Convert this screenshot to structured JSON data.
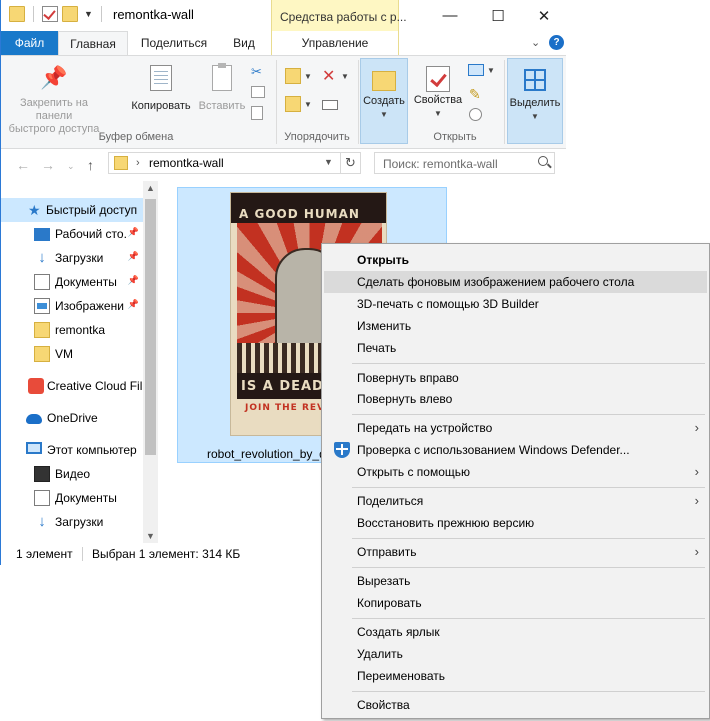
{
  "window": {
    "title": "remontka-wall",
    "tools_tab": "Средства работы с р...",
    "controls": {
      "minimize": "—",
      "maximize": "☐",
      "close": "✕"
    }
  },
  "ribbon_tabs": {
    "file": "Файл",
    "home": "Главная",
    "share": "Поделиться",
    "view": "Вид",
    "manage": "Управление",
    "help": "?"
  },
  "ribbon": {
    "pin": "Закрепить на панели быстрого доступа",
    "pin_l1": "Закрепить на панели",
    "pin_l2": "быстрого доступа",
    "copy": "Копировать",
    "paste": "Вставить",
    "clipboard_group": "Буфер обмена",
    "organize_group": "Упорядочить",
    "new": "Создать",
    "properties": "Свойства",
    "open_group": "Открыть",
    "select": "Выделить"
  },
  "address": {
    "path": "remontka-wall",
    "search_placeholder": "Поиск: remontka-wall"
  },
  "nav": {
    "items": [
      {
        "label": "Быстрый доступ",
        "icon": "star-icon"
      },
      {
        "label": "Рабочий сто.",
        "icon": "desktop-icon"
      },
      {
        "label": "Загрузки",
        "icon": "download-icon"
      },
      {
        "label": "Документы",
        "icon": "documents-icon"
      },
      {
        "label": "Изображени",
        "icon": "pictures-icon"
      },
      {
        "label": "remontka",
        "icon": "folder-icon"
      },
      {
        "label": "VM",
        "icon": "folder-icon"
      },
      {
        "label": "Creative Cloud Fil",
        "icon": "creative-cloud-icon"
      },
      {
        "label": "OneDrive",
        "icon": "onedrive-icon"
      },
      {
        "label": "Этот компьютер",
        "icon": "computer-icon"
      },
      {
        "label": "Видео",
        "icon": "video-icon"
      },
      {
        "label": "Документы",
        "icon": "documents-icon"
      },
      {
        "label": "Загрузки",
        "icon": "download-icon"
      }
    ]
  },
  "file": {
    "name": "robot_revolution_by_d",
    "poster_top": "A GOOD HUMAN",
    "poster_mid": "IS A DEAD",
    "poster_bottom": "JOIN THE REV"
  },
  "status": {
    "count": "1 элемент",
    "selected": "Выбран 1 элемент: 314 КБ"
  },
  "context_menu": {
    "open": "Открыть",
    "set_wallpaper": "Сделать фоновым изображением рабочего стола",
    "print3d": "3D-печать с помощью 3D Builder",
    "edit": "Изменить",
    "print": "Печать",
    "rotate_right": "Повернуть вправо",
    "rotate_left": "Повернуть влево",
    "cast": "Передать на устройство",
    "defender": "Проверка с использованием Windows Defender...",
    "open_with": "Открыть с помощью",
    "share": "Поделиться",
    "restore": "Восстановить прежнюю версию",
    "send_to": "Отправить",
    "cut": "Вырезать",
    "copy": "Копировать",
    "shortcut": "Создать ярлык",
    "delete": "Удалить",
    "rename": "Переименовать",
    "properties": "Свойства"
  }
}
